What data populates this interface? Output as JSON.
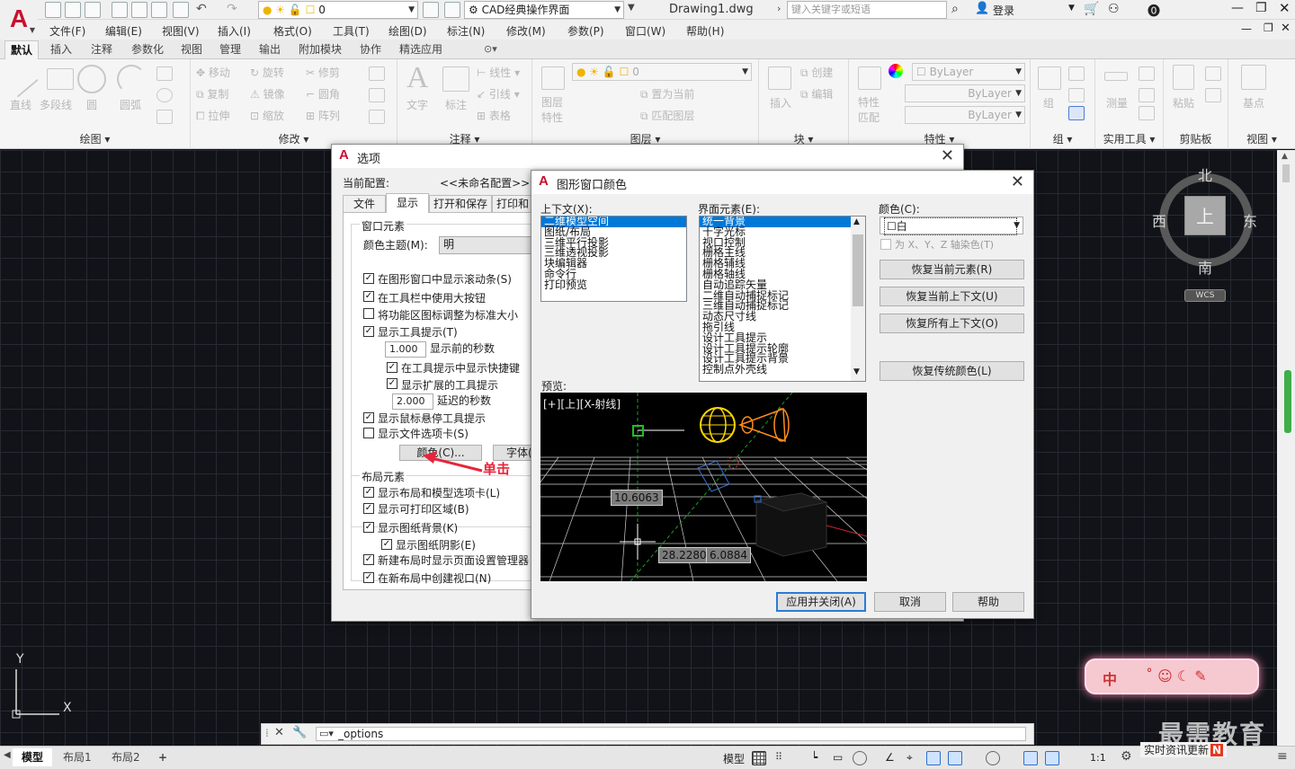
{
  "app": {
    "workspace": "CAD经典操作界面",
    "document_title": "Drawing1.dwg",
    "search_placeholder": "键入关键字或短语",
    "login": "登录",
    "layer_name": "0"
  },
  "menus": [
    "文件(F)",
    "编辑(E)",
    "视图(V)",
    "插入(I)",
    "格式(O)",
    "工具(T)",
    "绘图(D)",
    "标注(N)",
    "修改(M)",
    "参数(P)",
    "窗口(W)",
    "帮助(H)"
  ],
  "ribbon_tabs": [
    "默认",
    "插入",
    "注释",
    "参数化",
    "视图",
    "管理",
    "输出",
    "附加模块",
    "协作",
    "精选应用"
  ],
  "ribbon": {
    "draw": {
      "title": "绘图",
      "line": "直线",
      "polyline": "多段线",
      "circle": "圆",
      "arc": "圆弧"
    },
    "modify": {
      "title": "修改",
      "move": "移动",
      "rotate": "旋转",
      "trim": "修剪",
      "copy": "复制",
      "mirror": "镜像",
      "fillet": "圆角",
      "stretch": "拉伸",
      "scale": "缩放",
      "array": "阵列"
    },
    "annotation": {
      "title": "注释",
      "text": "文字",
      "dimension": "标注",
      "linear": "线性",
      "leader": "引线",
      "table": "表格"
    },
    "layers": {
      "title": "图层",
      "layer_props": "图层\n特性",
      "layer_value": "0",
      "set_current": "置为当前",
      "match_layer": "匹配图层"
    },
    "block": {
      "title": "块",
      "insert": "插入",
      "create": "创建",
      "edit": "编辑"
    },
    "properties": {
      "title": "特性",
      "match": "特性\n匹配",
      "color": "ByLayer",
      "linetype": "ByLayer",
      "lineweight": "ByLayer"
    },
    "groups": {
      "title": "组",
      "group": "组"
    },
    "utilities": {
      "title": "实用工具",
      "measure": "测量"
    },
    "clipboard": {
      "title": "剪贴板",
      "paste": "粘贴"
    },
    "view": {
      "title": "视图",
      "base": "基点"
    }
  },
  "viewcube": {
    "north": "北",
    "south": "南",
    "east": "东",
    "west": "西",
    "top": "上",
    "wcs": "WCS"
  },
  "ucs": {
    "x": "X",
    "y": "Y"
  },
  "command_line": {
    "value": "_options"
  },
  "layout_tabs": [
    "模型",
    "布局1",
    "布局2",
    "+"
  ],
  "status": {
    "model": "模型",
    "scale": "1:1"
  },
  "options_dialog": {
    "title": "选项",
    "current_profile_label": "当前配置:",
    "current_profile_value": "<<未命名配置>>",
    "tabs": [
      "文件",
      "显示",
      "打开和保存",
      "打印和"
    ],
    "window_elements_title": "窗口元素",
    "color_scheme_label": "颜色主题(M):",
    "color_scheme_value": "明",
    "checks": [
      {
        "label": "在图形窗口中显示滚动条(S)",
        "checked": true
      },
      {
        "label": "在工具栏中使用大按钮",
        "checked": true
      },
      {
        "label": "将功能区图标调整为标准大小",
        "checked": false
      },
      {
        "label": "显示工具提示(T)",
        "checked": true
      }
    ],
    "tooltip_delay_value": "1.000",
    "tooltip_delay_label": "显示前的秒数",
    "sub_checks": [
      {
        "label": "在工具提示中显示快捷键",
        "checked": true
      },
      {
        "label": "显示扩展的工具提示",
        "checked": true
      }
    ],
    "ext_delay_value": "2.000",
    "ext_delay_label": "延迟的秒数",
    "checks2": [
      {
        "label": "显示鼠标悬停工具提示",
        "checked": true
      },
      {
        "label": "显示文件选项卡(S)",
        "checked": false
      }
    ],
    "color_button": "颜色(C)...",
    "font_button": "字体(",
    "layout_elements_title": "布局元素",
    "layout_checks": [
      {
        "label": "显示布局和模型选项卡(L)",
        "checked": true
      },
      {
        "label": "显示可打印区域(B)",
        "checked": true
      },
      {
        "label": "显示图纸背景(K)",
        "checked": true
      },
      {
        "label": "显示图纸阴影(E)",
        "checked": true
      },
      {
        "label": "新建布局时显示页面设置管理器",
        "checked": true
      },
      {
        "label": "在新布局中创建视口(N)",
        "checked": true
      }
    ]
  },
  "annotation_text": "单击",
  "color_dialog": {
    "title": "图形窗口颜色",
    "context_label": "上下文(X):",
    "contexts": [
      "二维模型空间",
      "图纸/布局",
      "三维平行投影",
      "三维透视投影",
      "块编辑器",
      "命令行",
      "打印预览"
    ],
    "element_label": "界面元素(E):",
    "elements": [
      "统一背景",
      "十字光标",
      "视口控制",
      "栅格主线",
      "栅格辅线",
      "栅格轴线",
      "自动追踪矢量",
      "二维自动捕捉标记",
      "三维自动捕捉标记",
      "动态尺寸线",
      "拖引线",
      "设计工具提示",
      "设计工具提示轮廓",
      "设计工具提示背景",
      "控制点外壳线"
    ],
    "color_label": "颜色(C):",
    "color_value": "白",
    "tint_label": "为 X、Y、Z 轴染色(T)",
    "buttons": [
      "恢复当前元素(R)",
      "恢复当前上下文(U)",
      "恢复所有上下文(O)",
      "恢复传统颜色(L)"
    ],
    "preview_label": "预览:",
    "preview_viewport": "[+][上][X-射线]",
    "preview_values": [
      "10.6063",
      "28.2280",
      "6.0884"
    ],
    "apply": "应用并关闭(A)",
    "cancel": "取消",
    "help": "帮助"
  },
  "watermark": "最需教育",
  "news": "实时资讯更新",
  "ime": "中",
  "colors": {
    "accent": "#0078d7",
    "annotation": "#e8243a",
    "brand": "#c8102e",
    "canvas": "#111318"
  }
}
